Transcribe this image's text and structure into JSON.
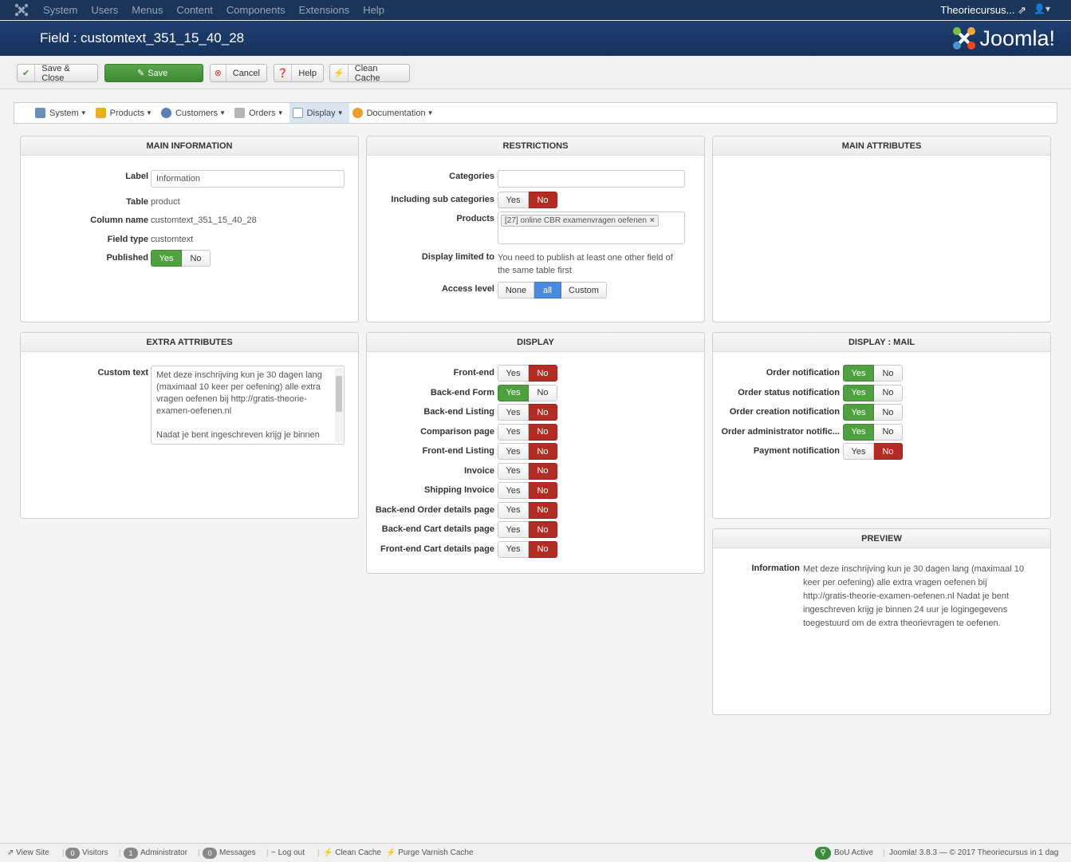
{
  "topnav": {
    "menus": [
      "System",
      "Users",
      "Menus",
      "Content",
      "Components",
      "Extensions",
      "Help"
    ],
    "site_name": "Theoriecursus...",
    "user_icon": "user-icon"
  },
  "header": {
    "title": "Field : customtext_351_15_40_28",
    "brand": "Joomla!"
  },
  "toolbar": {
    "save_close": "Save & Close",
    "save": "Save",
    "cancel": "Cancel",
    "help": "Help",
    "clean_cache": "Clean Cache"
  },
  "submenu": {
    "items": [
      {
        "label": "System",
        "icon": "tools-icon"
      },
      {
        "label": "Products",
        "icon": "products-icon"
      },
      {
        "label": "Customers",
        "icon": "customers-icon"
      },
      {
        "label": "Orders",
        "icon": "orders-icon"
      },
      {
        "label": "Display",
        "icon": "display-icon"
      },
      {
        "label": "Documentation",
        "icon": "documentation-icon"
      }
    ]
  },
  "main_information": {
    "title": "MAIN INFORMATION",
    "label_label": "Label",
    "label_value": "Information",
    "table_label": "Table",
    "table_value": "product",
    "column_label": "Column name",
    "column_value": "customtext_351_15_40_28",
    "type_label": "Field type",
    "type_value": "customtext",
    "published_label": "Published",
    "yes": "Yes",
    "no": "No"
  },
  "restrictions": {
    "title": "RESTRICTIONS",
    "categories_label": "Categories",
    "subcat_label": "Including sub categories",
    "products_label": "Products",
    "product_tag": "[27] online CBR examenvragen oefenen",
    "display_limited_label": "Display limited to",
    "display_limited_value": "You need to publish at least one other field of the same table first",
    "access_label": "Access level",
    "access_none": "None",
    "access_all": "all",
    "access_custom": "Custom"
  },
  "main_attributes": {
    "title": "MAIN ATTRIBUTES"
  },
  "extra_attributes": {
    "title": "EXTRA ATTRIBUTES",
    "custom_label": "Custom text",
    "custom_value": "Met deze inschrijving kun je 30 dagen lang (maximaal 10 keer per oefening) alle extra vragen oefenen bij http://gratis-theorie-examen-oefenen.nl\n\nNadat je bent ingeschreven krijg je binnen"
  },
  "display": {
    "title": "DISPLAY",
    "rows": [
      {
        "label": "Front-end",
        "state": "no"
      },
      {
        "label": "Back-end Form",
        "state": "yes"
      },
      {
        "label": "Back-end Listing",
        "state": "no"
      },
      {
        "label": "Comparison page",
        "state": "no"
      },
      {
        "label": "Front-end Listing",
        "state": "no"
      },
      {
        "label": "Invoice",
        "state": "no"
      },
      {
        "label": "Shipping Invoice",
        "state": "no"
      },
      {
        "label": "Back-end Order details page",
        "state": "no"
      },
      {
        "label": "Back-end Cart details page",
        "state": "no"
      },
      {
        "label": "Front-end Cart details page",
        "state": "no"
      }
    ]
  },
  "display_mail": {
    "title": "DISPLAY : MAIL",
    "rows": [
      {
        "label": "Order notification",
        "state": "yes"
      },
      {
        "label": "Order status notification",
        "state": "yes"
      },
      {
        "label": "Order creation notification",
        "state": "yes"
      },
      {
        "label": "Order administrator notific...",
        "state": "yes"
      },
      {
        "label": "Payment notification",
        "state": "no"
      }
    ]
  },
  "preview": {
    "title": "PREVIEW",
    "label": "Information",
    "text": "Met deze inschrijving kun je 30 dagen lang (maximaal 10 keer per oefening) alle extra vragen oefenen bij http://gratis-theorie-examen-oefenen.nl Nadat je bent ingeschreven krijg je binnen 24 uur je logingegevens toegestuurd om de extra theorievragen te oefenen."
  },
  "footer": {
    "view_site": "View Site",
    "visitors_count": "0",
    "visitors": "Visitors",
    "admin_count": "1",
    "administrator": "Administrator",
    "messages_count": "0",
    "messages": "Messages",
    "logout": "Log out",
    "clean_cache": "Clean Cache",
    "purge": "Purge Varnish Cache",
    "bou": "BoU Active",
    "version": "Joomla! 3.8.3",
    "copyright": "© 2017 Theoriecursus in 1 dag"
  },
  "colors": {
    "nav": "#1b3559",
    "header": "#1a3867",
    "green": "#50a040",
    "red": "#b22b25",
    "blue": "#4a89dc"
  }
}
